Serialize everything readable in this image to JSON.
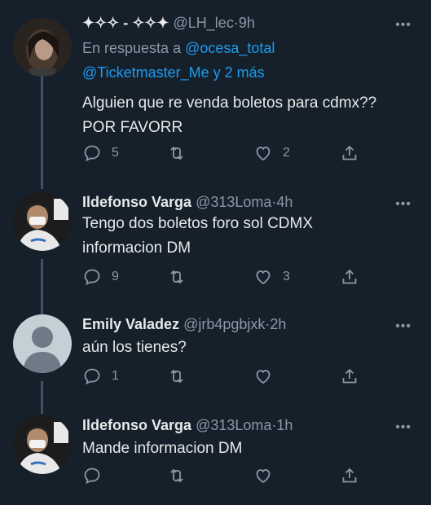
{
  "tweets": [
    {
      "name": "✦✧✧ - ✧✧✦",
      "handle": "@LH_lec",
      "time": "9h",
      "reply_prefix": "En respuesta a",
      "reply_mention_1": "@ocesa_total",
      "reply_mention_2": "@Ticketmaster_Me y 2 más",
      "text": "Alguien que re venda boletos para cdmx??\nPOR FAVORR",
      "replies": "5",
      "retweets": "",
      "likes": "2"
    },
    {
      "name": "Ildefonso Varga",
      "handle": "@313Loma",
      "time": "4h",
      "text": "Tengo dos boletos foro sol CDMX\ninformacion DM",
      "replies": "9",
      "retweets": "",
      "likes": "3"
    },
    {
      "name": "Emily Valadez",
      "handle": "@jrb4pgbjxk",
      "time": "2h",
      "text": "aún los tienes?",
      "replies": "1",
      "retweets": "",
      "likes": ""
    },
    {
      "name": "Ildefonso Varga",
      "handle": "@313Loma",
      "time": "1h",
      "text": "Mande informacion DM",
      "replies": "",
      "retweets": "",
      "likes": ""
    }
  ],
  "separator": "·",
  "more_label": "•••",
  "colors": {
    "background": "#15202b",
    "link": "#1d9bf0",
    "muted": "#8b98a5",
    "thread_line": "#3d5466"
  }
}
